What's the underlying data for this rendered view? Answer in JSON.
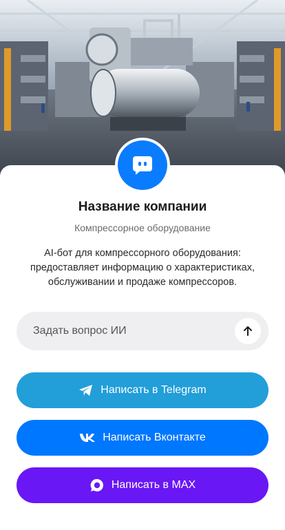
{
  "hero": {
    "image_alt_name": "industrial-compressor-image"
  },
  "company": {
    "name": "Название компании",
    "category": "Компрессорное оборудование",
    "description": "AI-бот для компрессорного оборудования: предоставляет информацию о характеристиках, обслуживании и продаже компрессоров."
  },
  "ask": {
    "placeholder": "Задать вопрос ИИ",
    "value": ""
  },
  "buttons": {
    "telegram": {
      "label": "Написать в Telegram",
      "icon": "telegram-icon",
      "color": "#229ed9"
    },
    "vk": {
      "label": "Написать Вконтакте",
      "icon": "vk-icon",
      "color": "#0077ff"
    },
    "max": {
      "label": "Написать в MAX",
      "icon": "max-icon",
      "color": "#6a17f5"
    }
  },
  "colors": {
    "avatar": "#0a7cff",
    "ask_bg": "#efeff1"
  }
}
